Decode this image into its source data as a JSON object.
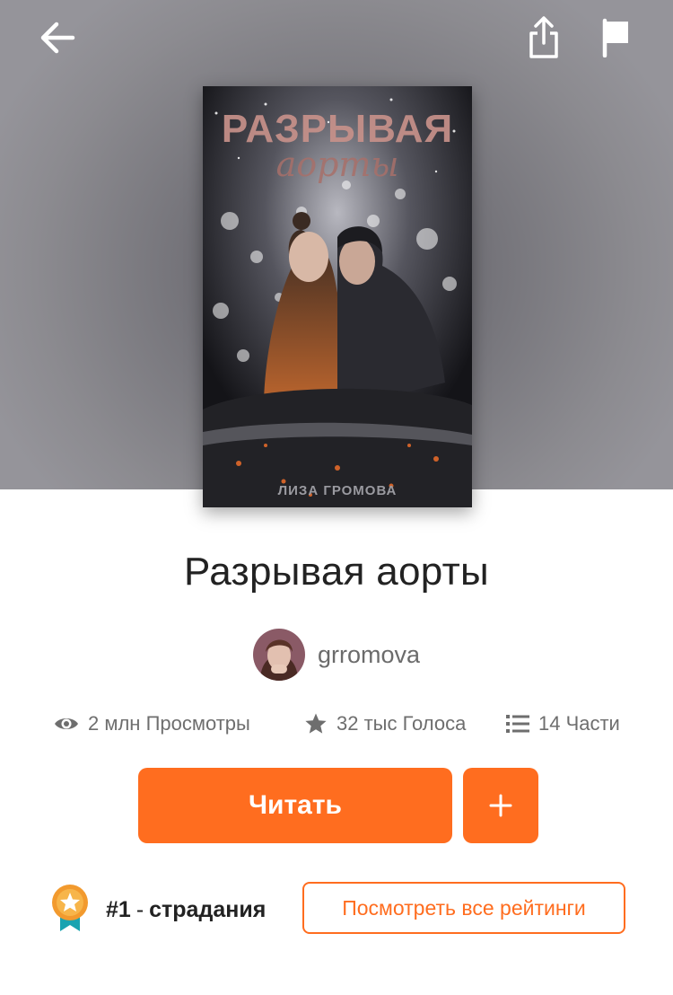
{
  "header": {
    "back_icon": "arrow-left-icon",
    "share_icon": "share-icon",
    "report_icon": "flag-icon"
  },
  "cover": {
    "title_text": "Разрывая аорты",
    "title_line1": "РАЗРЫВАЯ",
    "title_line2": "аорты",
    "author_text": "ЛИЗА ГРОМОВА"
  },
  "story": {
    "title": "Разрывая аорты",
    "author": "grromova"
  },
  "stats": {
    "views": "2 млн Просмотры",
    "votes": "32 тыс Голоса",
    "parts": "14 Части"
  },
  "actions": {
    "read_label": "Читать",
    "add_label": "+"
  },
  "ranking": {
    "rank": "#1",
    "separator": "-",
    "tag": "страдания",
    "view_all_label": "Посмотреть все рейтинги"
  },
  "colors": {
    "accent": "#ff6d1f",
    "text_primary": "#222222",
    "text_secondary": "#6e6e6e"
  }
}
